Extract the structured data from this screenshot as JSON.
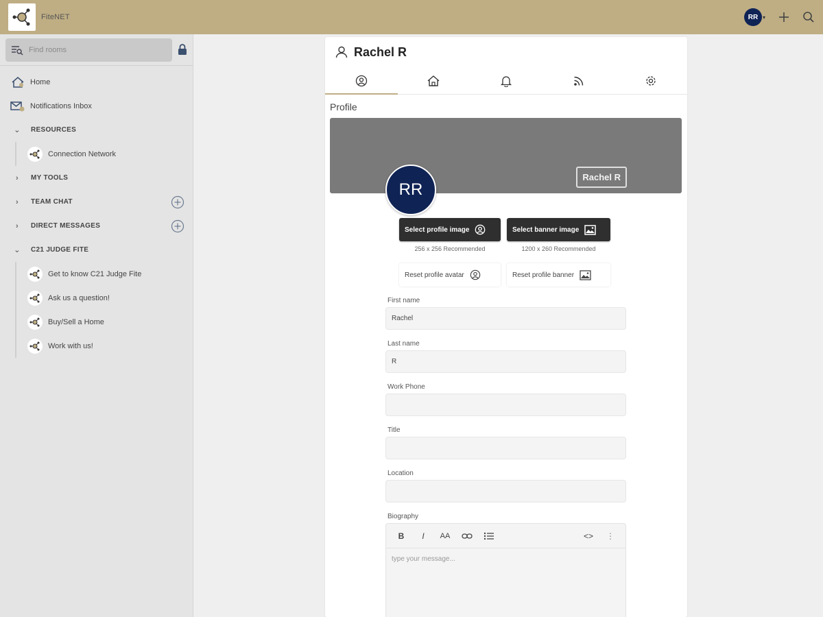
{
  "app": {
    "name": "FiteNET"
  },
  "topbar": {
    "user_initials": "RR",
    "caret": "▾"
  },
  "sidebar": {
    "search_placeholder": "Find rooms",
    "items": [
      {
        "label": "Home"
      },
      {
        "label": "Notifications Inbox"
      }
    ],
    "sections": {
      "resources": {
        "label": "RESOURCES",
        "chevron": "⌄",
        "items": [
          {
            "label": "Connection Network"
          }
        ]
      },
      "my_tools": {
        "label": "MY TOOLS",
        "chevron": "›"
      },
      "team_chat": {
        "label": "TEAM CHAT",
        "chevron": "›"
      },
      "direct_messages": {
        "label": "DIRECT MESSAGES",
        "chevron": "›"
      },
      "c21": {
        "label": "C21 JUDGE FITE",
        "chevron": "⌄",
        "items": [
          {
            "label": "Get to know C21 Judge Fite"
          },
          {
            "label": "Ask us a question!"
          },
          {
            "label": "Buy/Sell a Home"
          },
          {
            "label": "Work with us!"
          }
        ]
      }
    }
  },
  "profile": {
    "title": "Rachel R",
    "section_label": "Profile",
    "banner_name": "Rachel R",
    "avatar_initials": "RR",
    "select_profile_image": "Select profile image",
    "select_banner_image": "Select banner image",
    "profile_rec": "256 x 256 Recommended",
    "banner_rec": "1200 x 260 Recommended",
    "reset_avatar": "Reset profile avatar",
    "reset_banner": "Reset profile banner",
    "fields": {
      "first_name": {
        "label": "First name",
        "value": "Rachel"
      },
      "last_name": {
        "label": "Last name",
        "value": "R"
      },
      "work_phone": {
        "label": "Work Phone",
        "value": ""
      },
      "title": {
        "label": "Title",
        "value": ""
      },
      "location": {
        "label": "Location",
        "value": ""
      },
      "biography": {
        "label": "Biography",
        "placeholder": "type your message..."
      }
    },
    "toolbar": {
      "bold": "B",
      "italic": "I",
      "font_size": "AA",
      "code": "<>",
      "more": "⋮"
    }
  },
  "colors": {
    "topbar": "#bfae84",
    "avatar": "#0f2355",
    "banner": "#7a7a7a",
    "dark_button": "#2f2f2f"
  }
}
